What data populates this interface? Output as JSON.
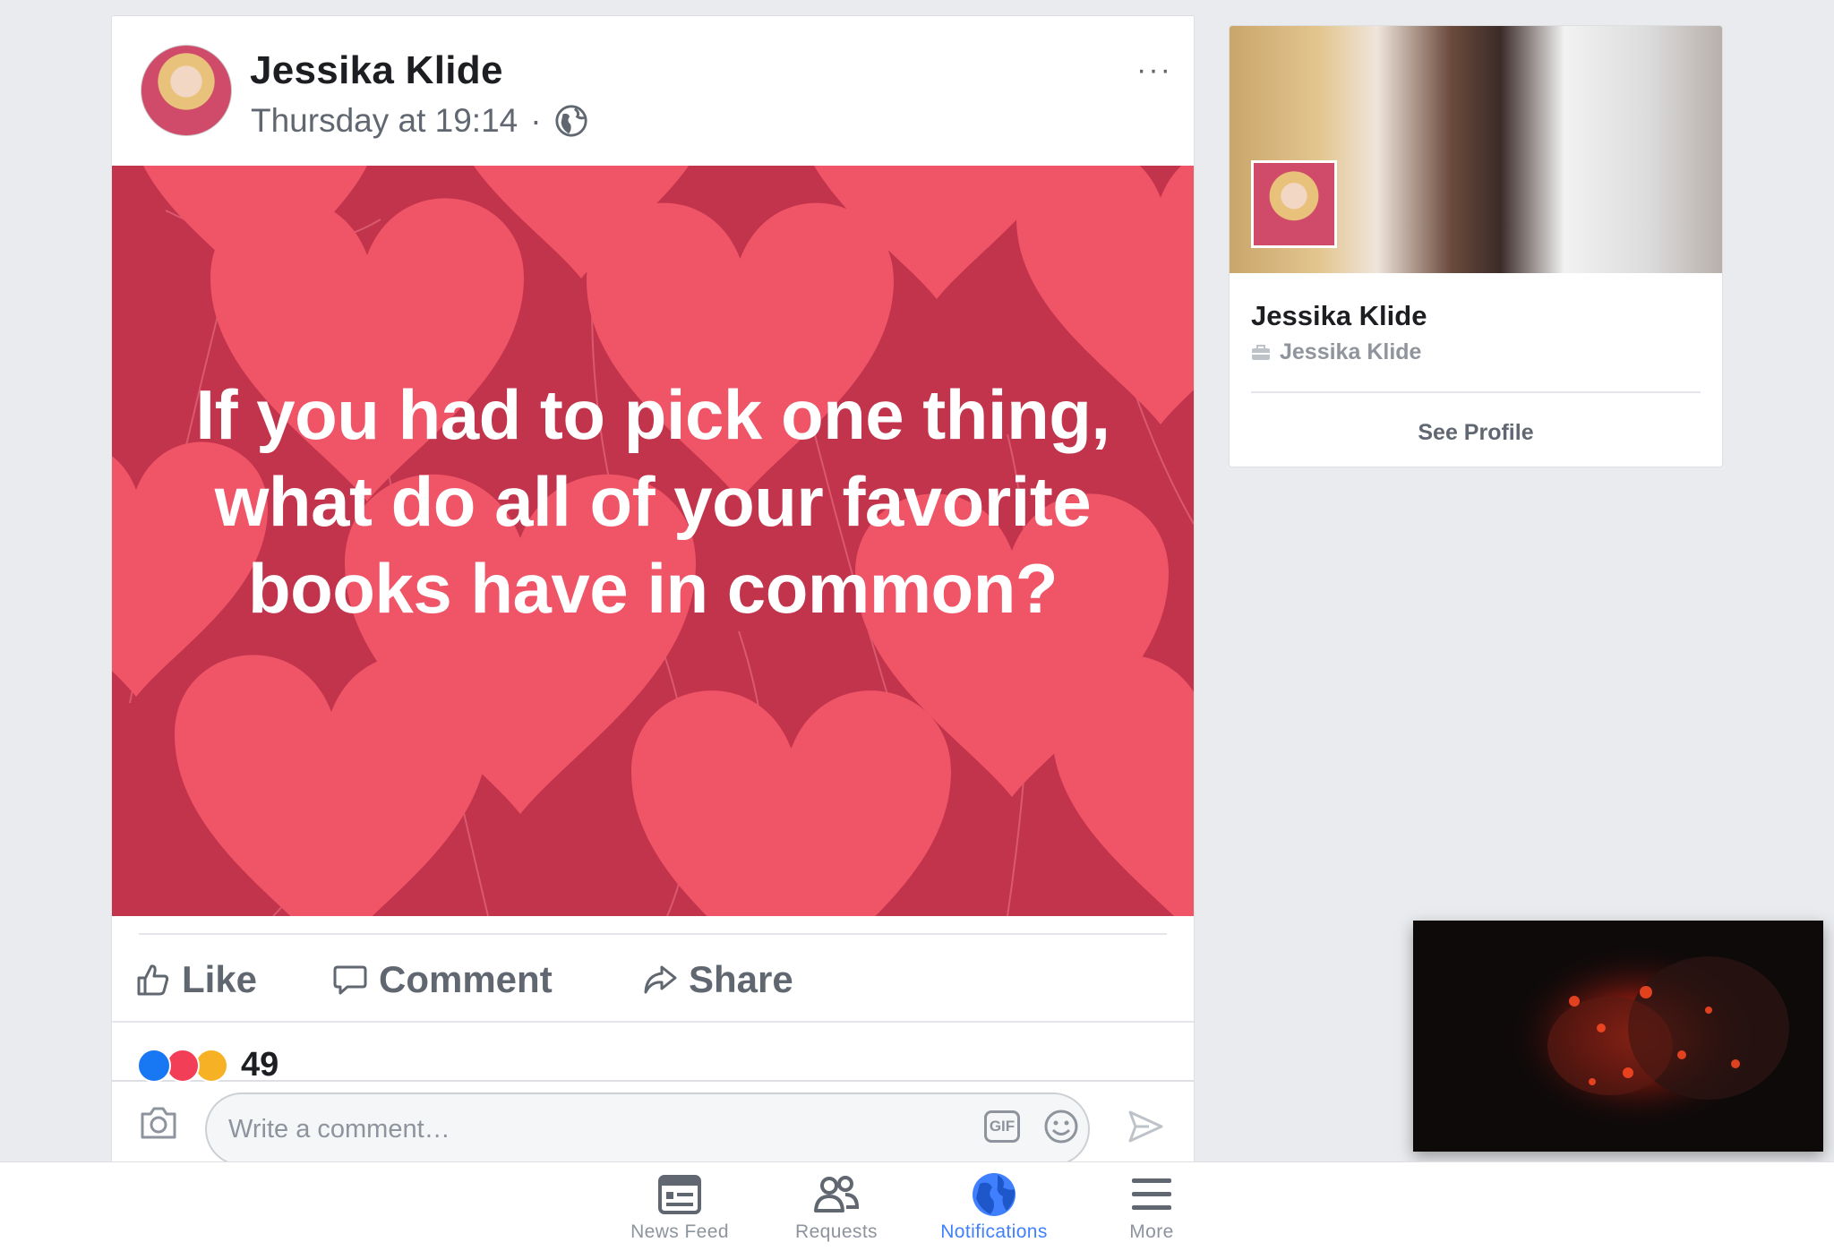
{
  "post": {
    "author": "Jessika Klide",
    "timestamp": "Thursday at 19:14",
    "separator": "·",
    "privacy_icon": "globe-icon",
    "more_label": "···",
    "image_text": "If you had to pick one thing, what do all of your favorite books have in common?",
    "actions": {
      "like": "Like",
      "comment": "Comment",
      "share": "Share"
    },
    "reactions": {
      "types": [
        "like",
        "love",
        "wow"
      ],
      "count": "49"
    },
    "comment_box": {
      "placeholder": "Write a comment…",
      "gif_label": "GIF"
    }
  },
  "profile_card": {
    "name": "Jessika Klide",
    "subtitle": "Jessika Klide",
    "button": "See Profile"
  },
  "tabbar": {
    "items": [
      {
        "label": "News Feed",
        "icon": "news-feed-icon"
      },
      {
        "label": "Requests",
        "icon": "friend-requests-icon"
      },
      {
        "label": "Notifications",
        "icon": "notifications-globe-icon",
        "active": true
      },
      {
        "label": "More",
        "icon": "menu-icon"
      }
    ]
  },
  "colors": {
    "accent": "#4080ff",
    "image_bg": "#c7364f",
    "heart": "#ef5467"
  }
}
